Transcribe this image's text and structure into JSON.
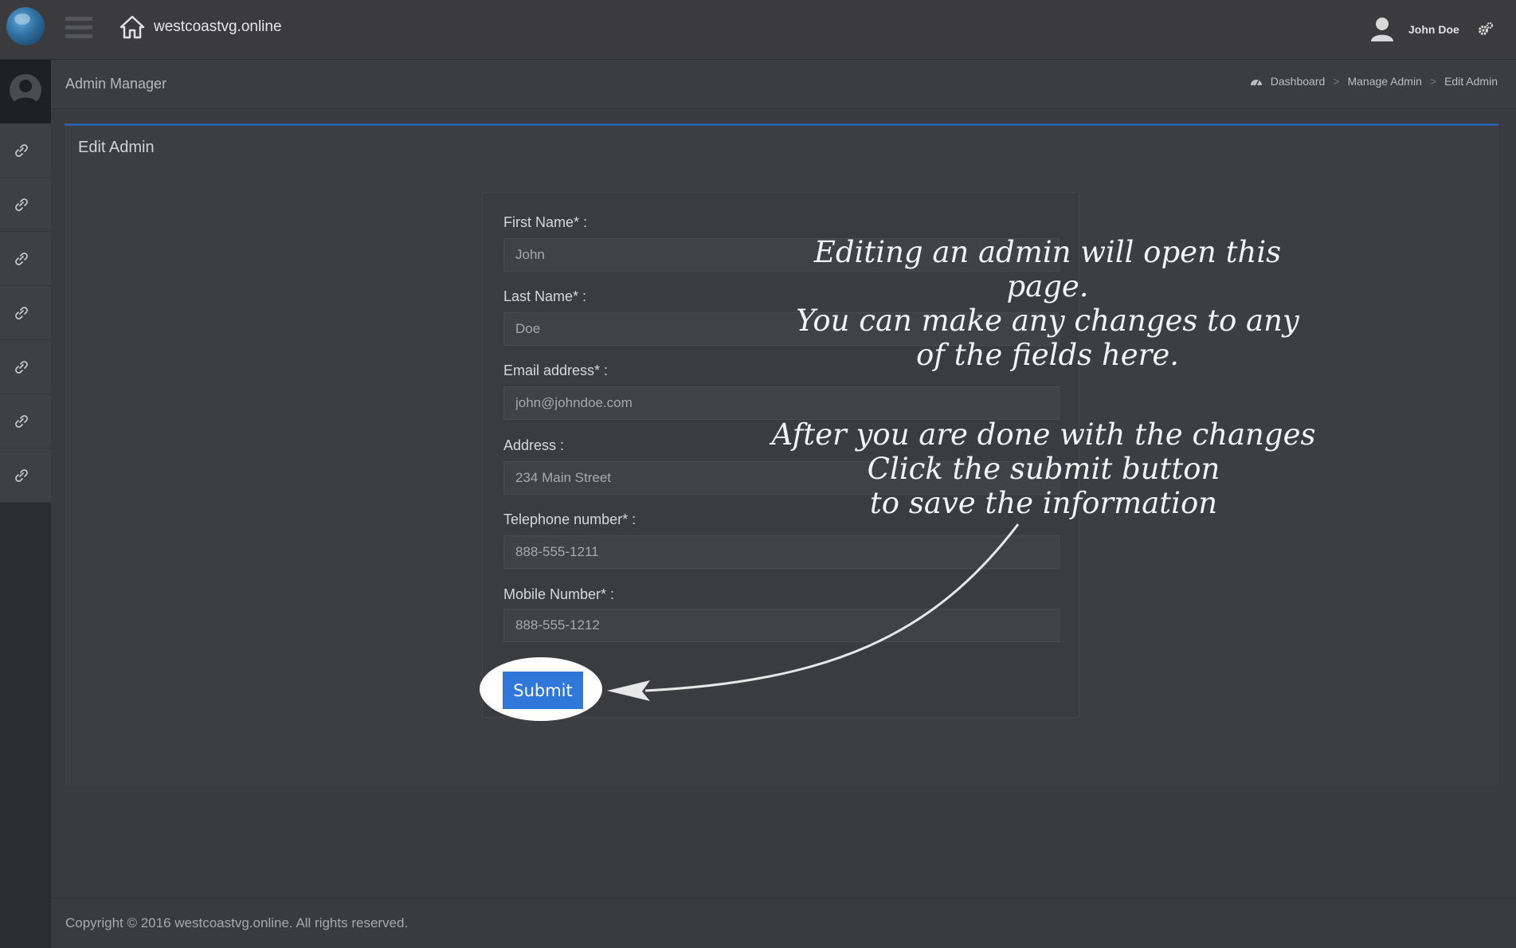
{
  "topbar": {
    "site_name": "westcoastvg.online",
    "user_name": "John Doe",
    "icons": [
      "globe-logo-icon",
      "hamburger-menu-icon",
      "home-icon",
      "user-icon",
      "gear-icon"
    ]
  },
  "sidebar": {
    "items": [
      {
        "icon": "link-icon"
      },
      {
        "icon": "link-icon"
      },
      {
        "icon": "link-icon"
      },
      {
        "icon": "link-icon"
      },
      {
        "icon": "link-icon"
      },
      {
        "icon": "link-icon"
      },
      {
        "icon": "link-icon"
      }
    ]
  },
  "header": {
    "title": "Admin Manager",
    "breadcrumb": [
      "Dashboard",
      "Manage Admin",
      "Edit Admin"
    ],
    "breadcrumb_separator": ">"
  },
  "panel": {
    "title": "Edit Admin",
    "fields": {
      "first_name": {
        "label": "First Name* :",
        "value": "John"
      },
      "last_name": {
        "label": "Last Name* :",
        "value": "Doe"
      },
      "email": {
        "label": "Email address* :",
        "value": "john@johndoe.com"
      },
      "address": {
        "label": "Address :",
        "value": "234 Main Street"
      },
      "telephone": {
        "label": "Telephone number* :",
        "value": "888-555-1211"
      },
      "mobile": {
        "label": "Mobile Number* :",
        "value": "888-555-1212"
      }
    },
    "submit_label": "Submit"
  },
  "annotations": {
    "note1": [
      "Editing an admin will open this page.",
      "You can make any  changes to any",
      "of the fields here."
    ],
    "note2": [
      "After you are done with the changes",
      "Click the submit button",
      "to save the information"
    ]
  },
  "footer": {
    "copyright": "Copyright © 2016 westcoastvg.online. All rights reserved."
  },
  "colors": {
    "accent": "#2f77d8",
    "panel_border": "#2b5fa8",
    "background": "#3a3b3e"
  }
}
